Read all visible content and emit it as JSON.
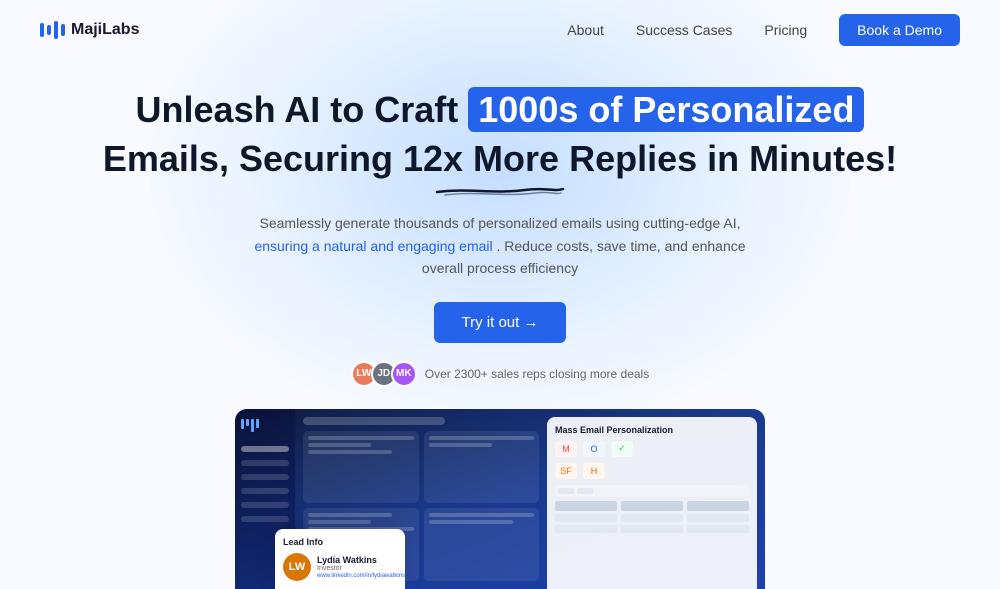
{
  "navbar": {
    "logo_text": "MajiLabs",
    "links": [
      {
        "label": "About",
        "id": "about"
      },
      {
        "label": "Success Cases",
        "id": "success-cases"
      },
      {
        "label": "Pricing",
        "id": "pricing"
      }
    ],
    "cta_label": "Book a Demo"
  },
  "hero": {
    "title_line1_pre": "Unleash AI to Craft",
    "title_highlight": "1000s of Personalized",
    "title_line2": "Emails, Securing 12x More Replies in Minutes!",
    "subtitle_pre": "Seamlessly generate thousands of personalized emails using cutting-edge AI,",
    "subtitle_link": "ensuring a natural and engaging email",
    "subtitle_post": ". Reduce costs, save time, and enhance overall process efficiency",
    "cta_label": "Try it out →",
    "social_proof_text": "Over 2300+ sales reps closing more deals"
  },
  "dashboard": {
    "right_panel_title": "Mass Email Personalization",
    "lead_card_title": "Lead Info",
    "lead_name": "Lydia Watkins",
    "lead_job": "Investor",
    "lead_linkedin": "www.linkedin.com/in/lydiawatkins"
  },
  "icons": {
    "gmail": "M",
    "outlook": "O",
    "other": "✓",
    "salesforce": "SF",
    "hubspot": "H"
  }
}
